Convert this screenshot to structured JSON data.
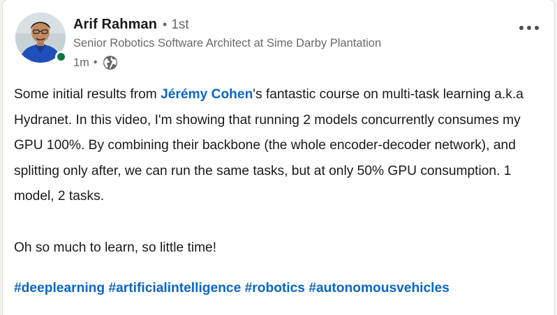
{
  "post": {
    "author": {
      "name": "Arif Rahman",
      "separator": "•",
      "degree": "1st",
      "headline": "Senior Robotics Software Architect at Sime Darby Plantation",
      "avatar_icon": "profile-photo",
      "presence_color": "#057642"
    },
    "meta": {
      "time": "1m",
      "separator": "•",
      "visibility_icon": "globe-icon"
    },
    "more_icon": "ellipsis-icon",
    "body": {
      "p1_before": "Some initial results from ",
      "mention": "Jérémy Cohen",
      "p1_after": "'s fantastic course on multi-task learning a.k.a Hydranet. In this video, I'm showing that running 2 models concurrently consumes my GPU 100%. By combining their backbone (the whole encoder-decoder network), and splitting only after, we can run the same tasks, but at only 50% GPU consumption. 1 model, 2 tasks.",
      "p2": "Oh so much to learn, so little time!"
    },
    "hashtags": [
      "#deeplearning",
      "#artificialintelligence",
      "#robotics",
      "#autonomousvehicles"
    ],
    "colors": {
      "link": "#0a66c2",
      "text": "#191919",
      "muted": "#666666"
    }
  }
}
